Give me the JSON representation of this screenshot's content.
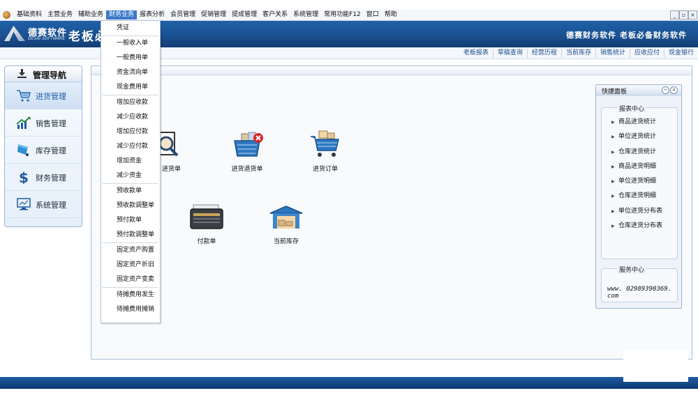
{
  "menubar": {
    "items": [
      "基础资料",
      "主营业务",
      "辅助业务",
      "财务业务",
      "报表分析",
      "会员管理",
      "促销管理",
      "提成管理",
      "客户关系",
      "系统管理",
      "常用功能F12",
      "窗口",
      "帮助"
    ],
    "active_index": 3,
    "window_controls": [
      "_",
      "▫",
      "×"
    ]
  },
  "banner": {
    "logo_cn": "德赛软件",
    "logo_en": "DESAI SOFTWARE",
    "title": "老板必",
    "slogan": "德赛财务软件 老板必备财务软件"
  },
  "quicklinks": [
    "老板报表",
    "草稿查询",
    "经营历程",
    "当前库存",
    "销售统计",
    "应收应付",
    "现金银行"
  ],
  "nav": {
    "title": "管理导航",
    "items": [
      "进货管理",
      "销售管理",
      "库存管理",
      "财务管理",
      "系统管理"
    ],
    "selected_index": 0
  },
  "tiles": {
    "t1": "进货单",
    "t2": "进货退货单",
    "t3": "进货订单",
    "t4": "付款单",
    "t5": "当前库存"
  },
  "quick_panel": {
    "title": "快捷面板",
    "report_center": {
      "title": "报表中心",
      "items": [
        "商品进货统计",
        "单位进货统计",
        "仓库进货统计",
        "商品进货明细",
        "单位进货明细",
        "仓库进货明细",
        "单位进货分布表",
        "仓库进货分布表"
      ]
    },
    "service_center": {
      "title": "服务中心",
      "text": "www. 02989390369. com"
    }
  },
  "dropdown": {
    "groups": [
      [
        "凭证"
      ],
      [
        "一般收入单",
        "一般费用单",
        "资金流向单",
        "现金费用单"
      ],
      [
        "增加应收款",
        "减少应收款",
        "增加应付款",
        "减少应付款",
        "增加资金",
        "减少资金"
      ],
      [
        "预收款单",
        "预收款调整单",
        "预付款单",
        "预付款调整单"
      ],
      [
        "固定资产购置",
        "固定资产折旧",
        "固定资产变卖"
      ],
      [
        "待摊费用发生",
        "待摊费用摊销"
      ]
    ]
  },
  "colors": {
    "banner": "#1a4f8f",
    "menu_active": "#3c78c8",
    "statusbar": "#0f3a70"
  }
}
